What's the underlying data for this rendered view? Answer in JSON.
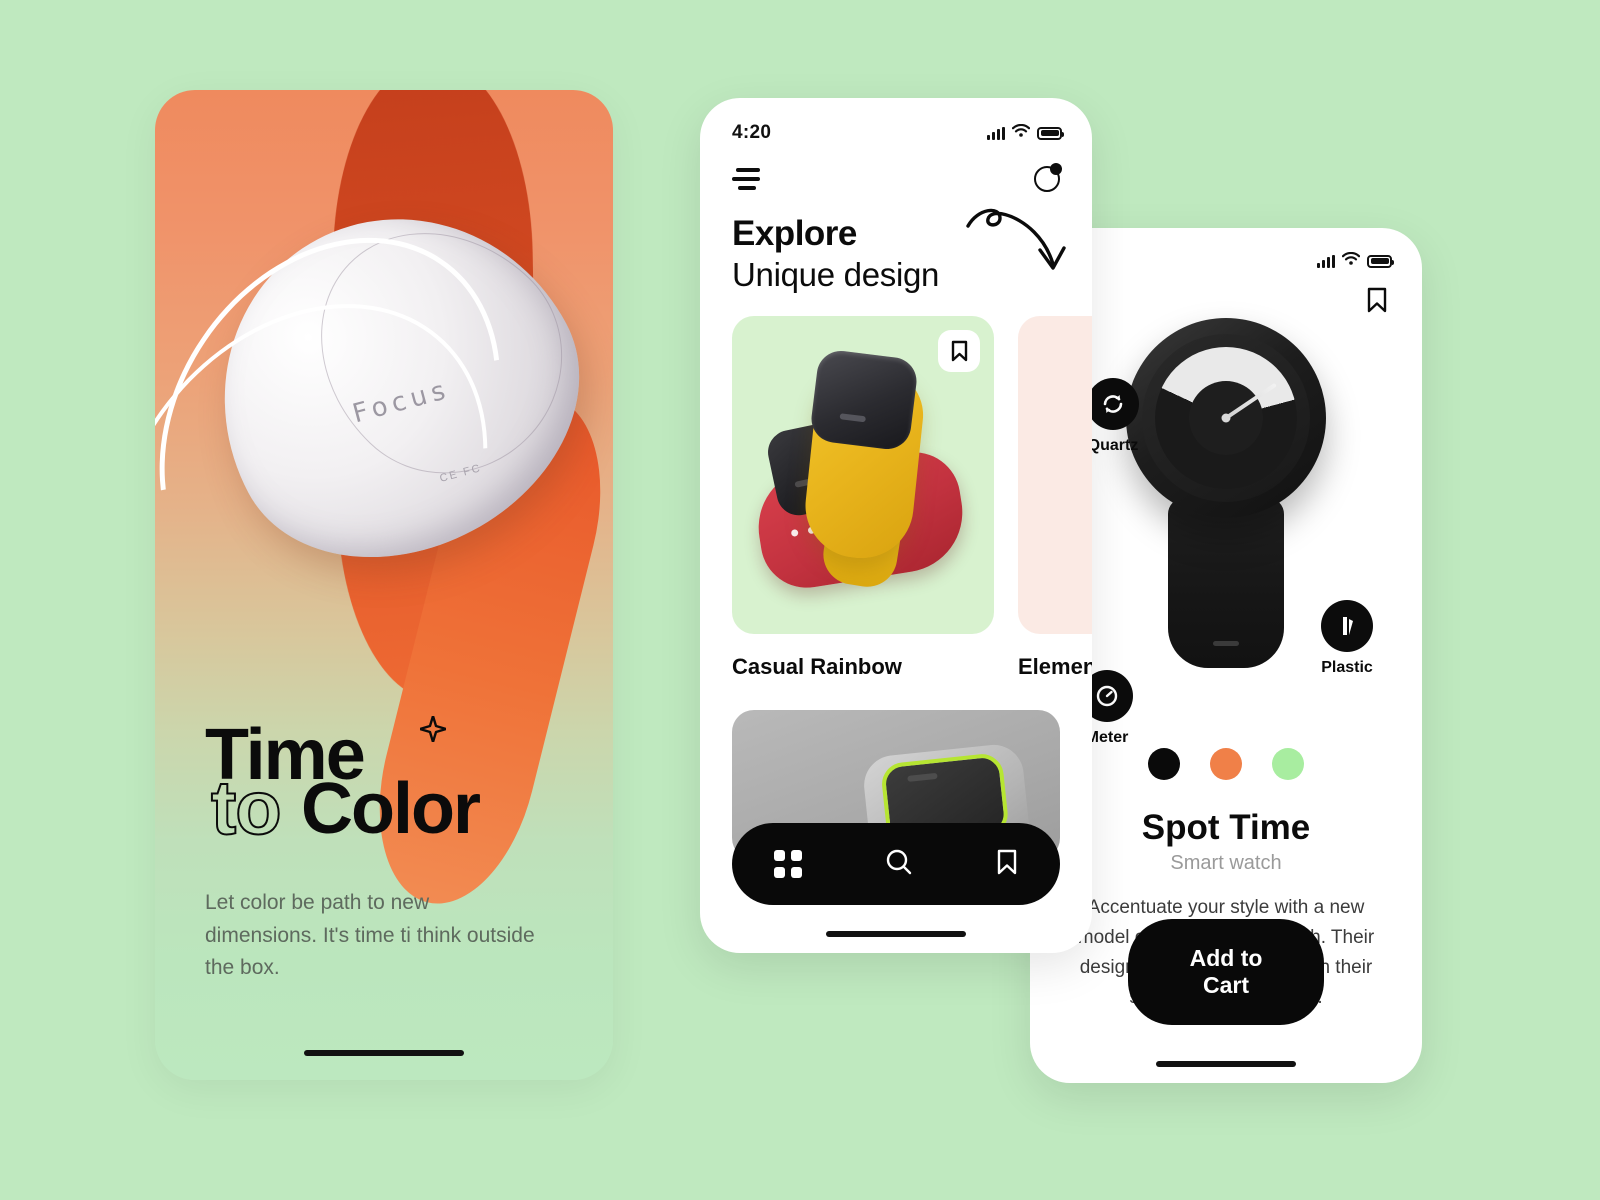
{
  "canvas": {
    "background_color": "#bfe9bf"
  },
  "left_phone": {
    "product_engraving": "Focus",
    "product_subtext": "CE FC",
    "title_line1": "Time",
    "title_line2_outline": "to",
    "title_line2_solid": "Color",
    "sparkle_icon": "sparkle-icon",
    "subtitle": "Let color be path to new dimensions. It's time ti think outside the box."
  },
  "mid_phone": {
    "status": {
      "time": "4:20",
      "signal_icon": "signal-bars-icon",
      "wifi_icon": "wifi-icon",
      "battery_icon": "battery-icon"
    },
    "menu_icon": "hamburger-menu-icon",
    "profile_icon": "profile-notification-icon",
    "heading_bold": "Explore",
    "heading_light": "Unique design",
    "arrow_icon": "curved-arrow-icon",
    "cards": [
      {
        "title": "Casual Rainbow",
        "bg_color": "#d8f2cf",
        "bookmark_icon": "bookmark-icon"
      },
      {
        "title": "Element",
        "bg_color": "#fbeae4"
      }
    ],
    "nav": [
      {
        "icon": "grid-icon",
        "label": "Home"
      },
      {
        "icon": "search-icon",
        "label": "Search"
      },
      {
        "icon": "bookmark-icon",
        "label": "Saved"
      }
    ]
  },
  "right_phone": {
    "status": {
      "signal_icon": "signal-bars-icon",
      "wifi_icon": "wifi-icon",
      "battery_icon": "battery-icon"
    },
    "bookmark_icon": "bookmark-icon",
    "badges": [
      {
        "label": "Quartz",
        "icon": "refresh-icon"
      },
      {
        "label": "Meter",
        "icon": "meter-icon"
      },
      {
        "label": "Plastic",
        "icon": "plastic-icon"
      }
    ],
    "swatches": [
      {
        "name": "black",
        "color": "#0a0a0a"
      },
      {
        "name": "orange",
        "color": "#f08048"
      },
      {
        "name": "green",
        "color": "#a8eda0"
      }
    ],
    "product_title": "Spot Time",
    "product_subtitle": "Smart watch",
    "product_description": "Accentuate your style with a new model of quartz chronograph. Their designs are eye-catching with their striking gold and black.",
    "cart_button": "Add to Cart"
  }
}
